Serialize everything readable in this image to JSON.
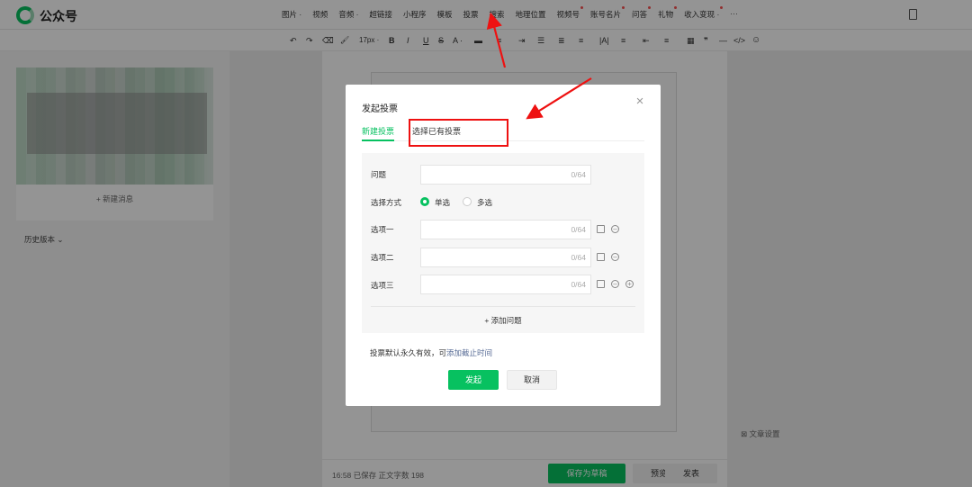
{
  "app": {
    "brand": "公众号"
  },
  "menu": [
    {
      "label": "图片 ·",
      "dot": false
    },
    {
      "label": "视频",
      "dot": false
    },
    {
      "label": "音频 ·",
      "dot": false
    },
    {
      "label": "超链接",
      "dot": false
    },
    {
      "label": "小程序",
      "dot": false
    },
    {
      "label": "模板",
      "dot": false
    },
    {
      "label": "投票",
      "dot": false
    },
    {
      "label": "搜索",
      "dot": false
    },
    {
      "label": "地理位置",
      "dot": false
    },
    {
      "label": "视频号",
      "dot": true
    },
    {
      "label": "账号名片",
      "dot": true
    },
    {
      "label": "问答",
      "dot": true
    },
    {
      "label": "礼物",
      "dot": true
    },
    {
      "label": "收入变现 ·",
      "dot": true
    },
    {
      "label": "···",
      "dot": false
    }
  ],
  "toolbar": {
    "undo": "↶",
    "redo": "↷",
    "eraser": "⌫",
    "format_brush": "🖌",
    "font_size": "17px ·",
    "bold": "B",
    "italic": "I",
    "underline": "U",
    "strikethrough": "S",
    "font_color": "A ·",
    "bg_color": "▬",
    "align": "≡",
    "indent": "⇥",
    "list": "☰",
    "line_height": "≣",
    "heading": "≡",
    "letter_spacing": "|A|",
    "more_a": "≡",
    "more_b": "⇤",
    "table": "▦",
    "quote": "❞",
    "hr": "—",
    "code": "</>",
    "emoji": "☺"
  },
  "left_panel": {
    "new_message": "+ 新建消息",
    "history": "历史版本 ⌄"
  },
  "right_panel": {
    "text_setting": "⊠ 文章设置"
  },
  "bottom": {
    "save_info": "16:58  已保存    正文字数  198",
    "save_draft": "保存为草稿",
    "preview": "预览",
    "publish": "发表"
  },
  "modal": {
    "title": "发起投票",
    "close": "×",
    "tab_new": "新建投票",
    "tab_existing": "选择已有投票",
    "question_label": "问题",
    "question_counter": "0/64",
    "mode_label": "选择方式",
    "single": "单选",
    "multiple": "多选",
    "option1_label": "选项一",
    "option2_label": "选项二",
    "option3_label": "选项三",
    "option_counter": "0/64",
    "add_question": "+ 添加问题",
    "note_prefix": "投票默认永久有效，可",
    "note_link": "添加截止时间",
    "start": "发起",
    "cancel": "取消"
  }
}
